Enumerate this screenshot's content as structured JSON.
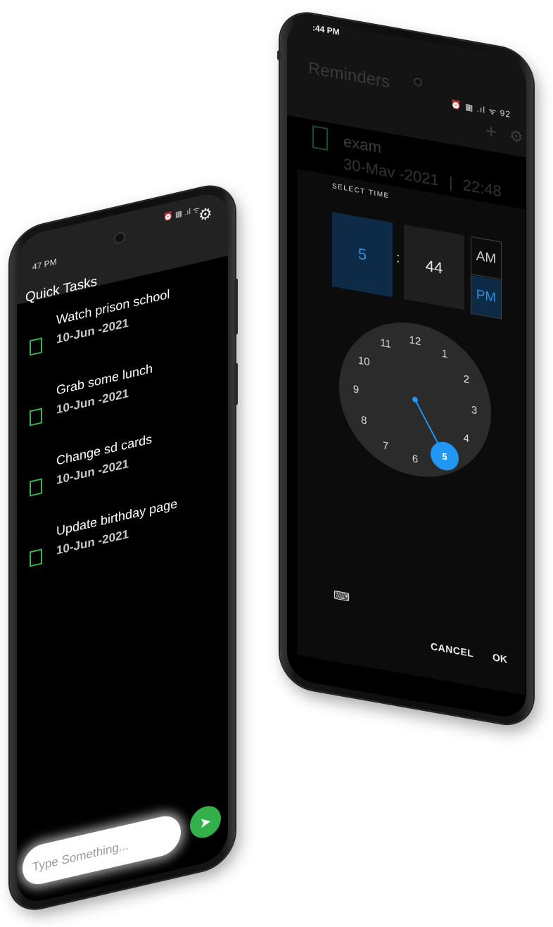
{
  "left_phone": {
    "status_time": "47 PM",
    "status_icons": "⏰ ▦ .ıl ᯤ",
    "app_title": "Quick Tasks",
    "settings_icon": "gear-icon",
    "tasks": [
      {
        "title": "Watch prison school",
        "date": "10-Jun -2021"
      },
      {
        "title": "Grab some lunch",
        "date": "10-Jun -2021"
      },
      {
        "title": "Change sd cards",
        "date": "10-Jun -2021"
      },
      {
        "title": "Update birthday page",
        "date": "10-Jun -2021"
      }
    ],
    "input": {
      "placeholder": "Type Something..."
    },
    "send_icon": "send-icon",
    "colors": {
      "accent": "#33b04a",
      "checkbox": "#3cb054"
    }
  },
  "right_phone": {
    "status_time": ":44 PM",
    "status_icons": "⏰ ▦ .ıl ᯤ 92",
    "app_title": "Reminders",
    "add_icon": "plus-icon",
    "settings_icon": "gear-icon",
    "reminder": {
      "title": "exam",
      "date": "30-Mav -2021",
      "separator": "|",
      "time": "22:48"
    },
    "time_picker": {
      "header": "SELECT TIME",
      "hour": "5",
      "colon": ":",
      "minute": "44",
      "am": "AM",
      "pm": "PM",
      "selected_period": "PM",
      "clock_numbers": [
        "12",
        "1",
        "2",
        "3",
        "4",
        "5",
        "6",
        "7",
        "8",
        "9",
        "10",
        "11"
      ],
      "selected_hour": 5,
      "keyboard_icon": "keyboard-icon",
      "cancel_label": "CANCEL",
      "ok_label": "OK"
    },
    "colors": {
      "accent": "#2196f3",
      "selected_bg": "#0d2a47"
    }
  }
}
